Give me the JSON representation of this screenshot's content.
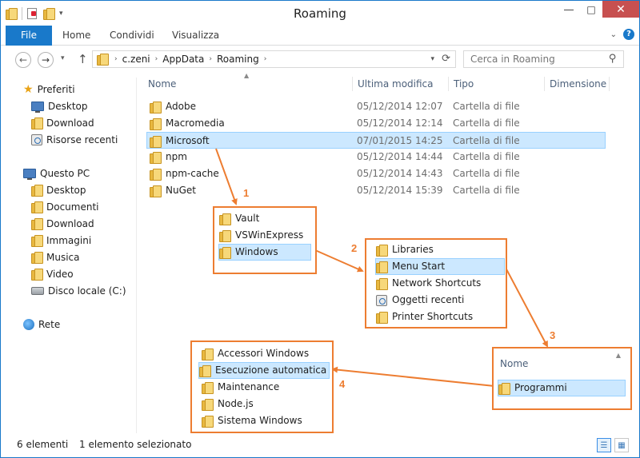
{
  "window": {
    "title": "Roaming"
  },
  "ribbon": {
    "tabs": [
      "File",
      "Home",
      "Condividi",
      "Visualizza"
    ]
  },
  "address": {
    "crumbs": [
      "c.zeni",
      "AppData",
      "Roaming"
    ],
    "search_placeholder": "Cerca in Roaming"
  },
  "navpane": {
    "favorites_label": "Preferiti",
    "favorites": [
      "Desktop",
      "Download",
      "Risorse recenti"
    ],
    "pc_label": "Questo PC",
    "pc_items": [
      "Desktop",
      "Documenti",
      "Download",
      "Immagini",
      "Musica",
      "Video",
      "Disco locale (C:)"
    ],
    "network_label": "Rete"
  },
  "list": {
    "columns": [
      "Nome",
      "Ultima modifica",
      "Tipo",
      "Dimensione"
    ],
    "rows": [
      {
        "name": "Adobe",
        "date": "05/12/2014 12:07",
        "type": "Cartella di file"
      },
      {
        "name": "Macromedia",
        "date": "05/12/2014 12:14",
        "type": "Cartella di file"
      },
      {
        "name": "Microsoft",
        "date": "07/01/2015 14:25",
        "type": "Cartella di file",
        "selected": true
      },
      {
        "name": "npm",
        "date": "05/12/2014 14:44",
        "type": "Cartella di file"
      },
      {
        "name": "npm-cache",
        "date": "05/12/2014 14:43",
        "type": "Cartella di file"
      },
      {
        "name": "NuGet",
        "date": "05/12/2014 15:39",
        "type": "Cartella di file"
      }
    ]
  },
  "annotations": {
    "step1": {
      "number": "1",
      "items": [
        "Vault",
        "VSWinExpress",
        "Windows"
      ],
      "selected": "Windows"
    },
    "step2": {
      "number": "2",
      "items": [
        "Libraries",
        "Menu Start",
        "Network Shortcuts",
        "Oggetti recenti",
        "Printer Shortcuts"
      ],
      "selected": "Menu Start"
    },
    "step3": {
      "number": "3",
      "header": "Nome",
      "items": [
        "Programmi"
      ],
      "selected": "Programmi"
    },
    "step4": {
      "number": "4",
      "items": [
        "Accessori Windows",
        "Esecuzione automatica",
        "Maintenance",
        "Node.js",
        "Sistema Windows"
      ],
      "selected": "Esecuzione automatica"
    }
  },
  "status": {
    "count": "6 elementi",
    "selection": "1 elemento selezionato"
  },
  "colors": {
    "accent": "#1979ca",
    "annotation": "#ed7d31",
    "selection": "#cce8ff"
  }
}
